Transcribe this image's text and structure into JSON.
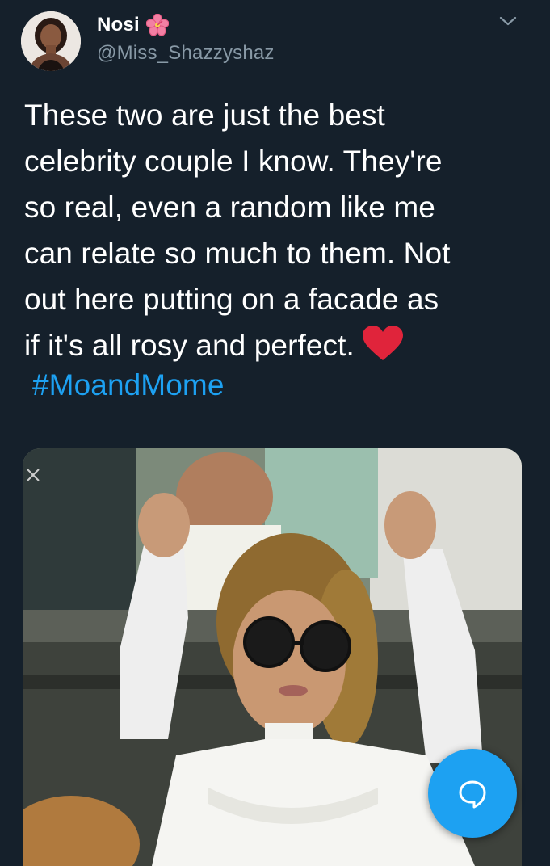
{
  "user": {
    "display_name": "Nosi",
    "name_emoji_icon": "hibiscus-flower-icon",
    "handle": "@Miss_Shazzyshaz",
    "avatar": "profile-photo"
  },
  "tweet": {
    "lines": [
      "These two are just the best",
      "celebrity couple I know. They're",
      "so real, even a random like me",
      "can relate so much to them. Not",
      "out here putting on a facade as",
      "if it's all rosy and perfect."
    ],
    "end_emoji_icon": "red-heart-icon",
    "hashtag": "#MoandMome"
  },
  "media": {
    "kind": "photo",
    "description_icon": "photo-woman-sunglasses-fists-raised"
  },
  "actions": {
    "menu_icon": "chevron-down-icon",
    "fab_icon": "reply-bubble-icon"
  },
  "colors": {
    "background": "#15202b",
    "text": "#ffffff",
    "secondary_text": "#8899a6",
    "link": "#1da1f2",
    "fab": "#1da1f2",
    "heart": "#e0243b"
  }
}
